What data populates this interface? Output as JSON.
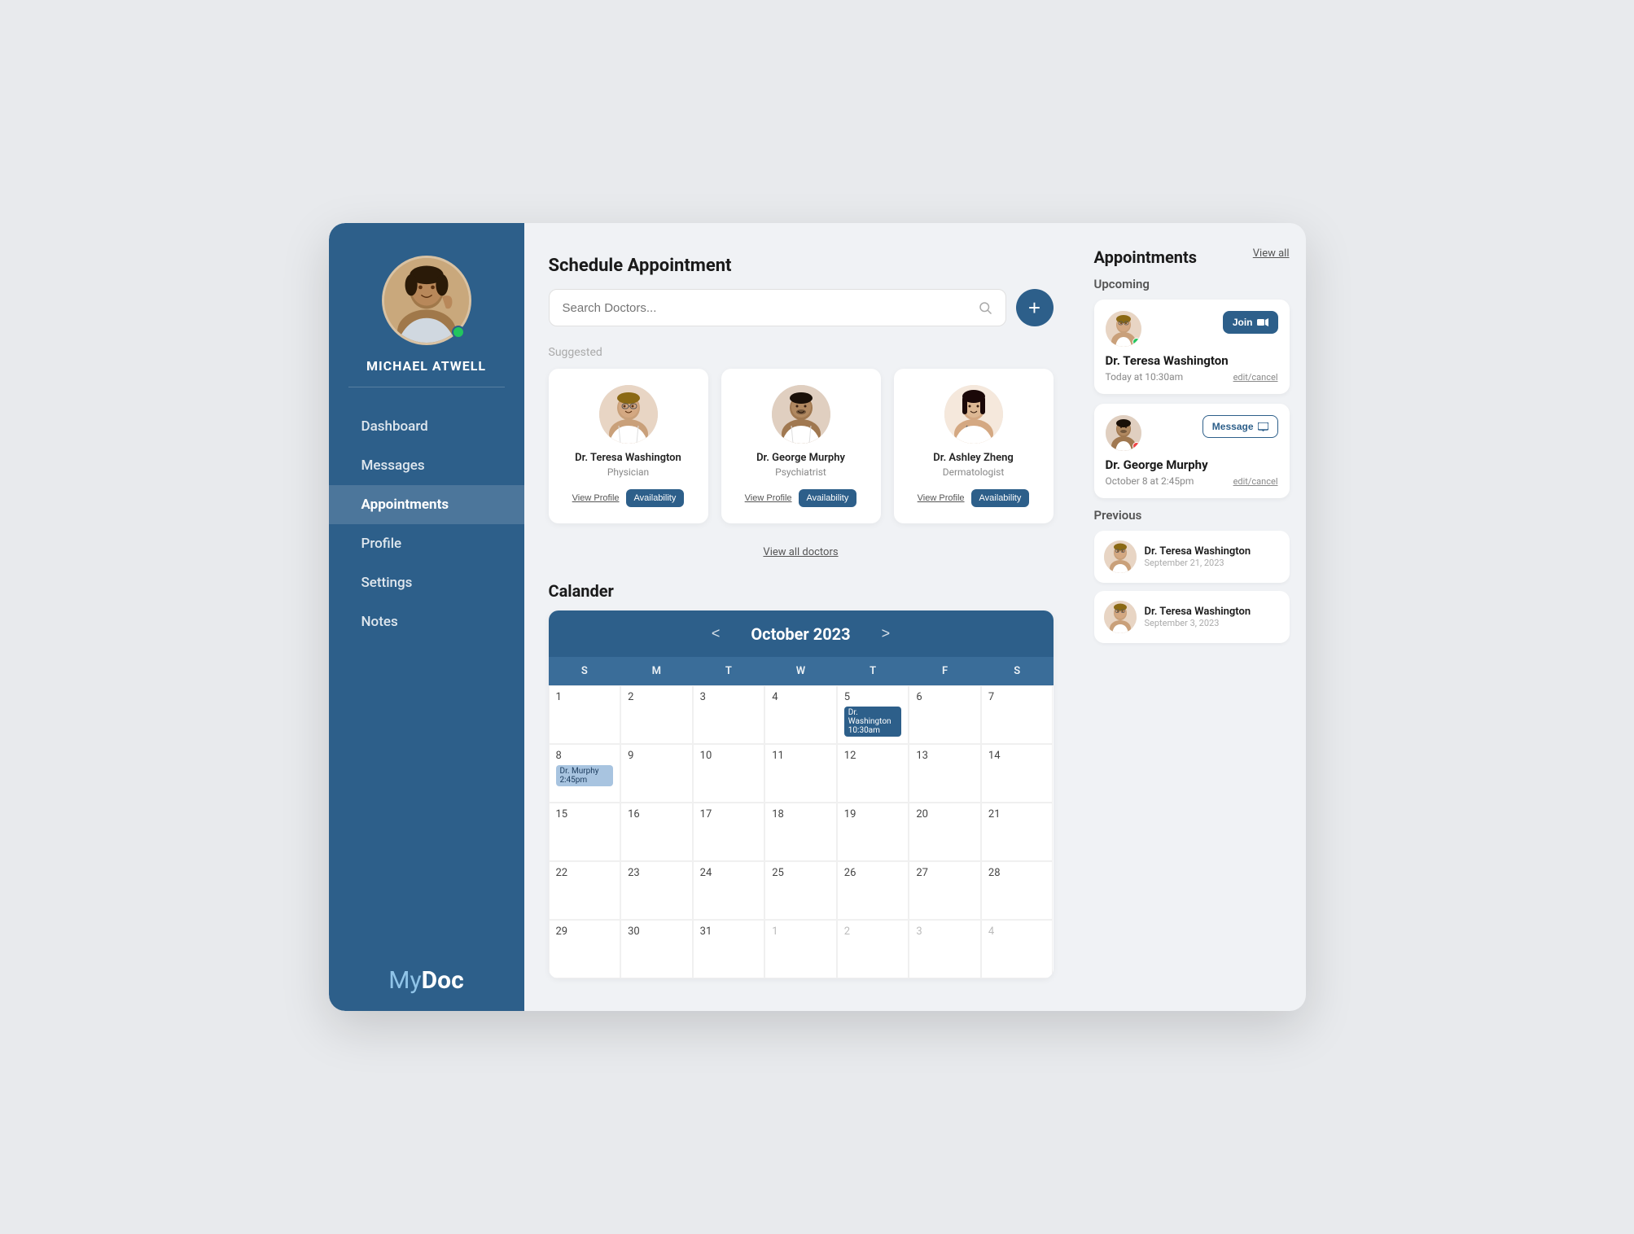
{
  "app": {
    "brand_my": "My",
    "brand_doc": "Doc"
  },
  "sidebar": {
    "user_name": "MICHAEL ATWELL",
    "nav_items": [
      {
        "id": "dashboard",
        "label": "Dashboard",
        "active": false
      },
      {
        "id": "messages",
        "label": "Messages",
        "active": false
      },
      {
        "id": "appointments",
        "label": "Appointments",
        "active": true
      },
      {
        "id": "profile",
        "label": "Profile",
        "active": false
      },
      {
        "id": "settings",
        "label": "Settings",
        "active": false
      },
      {
        "id": "notes",
        "label": "Notes",
        "active": false
      }
    ]
  },
  "schedule": {
    "title": "Schedule Appointment",
    "search_placeholder": "Search Doctors...",
    "add_button_label": "+",
    "suggested_label": "Suggested",
    "view_all_doctors": "View all doctors"
  },
  "doctors": [
    {
      "name": "Dr. Teresa Washington",
      "specialty": "Physician",
      "view_profile": "View Profile",
      "availability": "Availability"
    },
    {
      "name": "Dr. George Murphy",
      "specialty": "Psychiatrist",
      "view_profile": "View Profile",
      "availability": "Availability"
    },
    {
      "name": "Dr. Ashley Zheng",
      "specialty": "Dermatologist",
      "view_profile": "View Profile",
      "availability": "Availability"
    }
  ],
  "calendar": {
    "title": "Calander",
    "month_year": "October 2023",
    "prev_label": "<",
    "next_label": ">",
    "day_headers": [
      "S",
      "M",
      "T",
      "W",
      "T",
      "F",
      "S"
    ],
    "weeks": [
      [
        {
          "date": "1",
          "faded": false,
          "event": null
        },
        {
          "date": "2",
          "faded": false,
          "event": null
        },
        {
          "date": "3",
          "faded": false,
          "event": null
        },
        {
          "date": "4",
          "faded": false,
          "event": null
        },
        {
          "date": "5",
          "faded": false,
          "event": "Dr. Washington 10:30am",
          "highlight": true
        },
        {
          "date": "6",
          "faded": false,
          "event": null
        },
        {
          "date": "7",
          "faded": false,
          "event": null
        }
      ],
      [
        {
          "date": "8",
          "faded": false,
          "event": "Dr. Murphy 2:45pm",
          "highlight": false
        },
        {
          "date": "9",
          "faded": false,
          "event": null
        },
        {
          "date": "10",
          "faded": false,
          "event": null
        },
        {
          "date": "11",
          "faded": false,
          "event": null
        },
        {
          "date": "12",
          "faded": false,
          "event": null
        },
        {
          "date": "13",
          "faded": false,
          "event": null
        },
        {
          "date": "14",
          "faded": false,
          "event": null
        }
      ],
      [
        {
          "date": "15",
          "faded": false,
          "event": null
        },
        {
          "date": "16",
          "faded": false,
          "event": null
        },
        {
          "date": "17",
          "faded": false,
          "event": null
        },
        {
          "date": "18",
          "faded": false,
          "event": null
        },
        {
          "date": "19",
          "faded": false,
          "event": null
        },
        {
          "date": "20",
          "faded": false,
          "event": null
        },
        {
          "date": "21",
          "faded": false,
          "event": null
        }
      ],
      [
        {
          "date": "22",
          "faded": false,
          "event": null
        },
        {
          "date": "23",
          "faded": false,
          "event": null
        },
        {
          "date": "24",
          "faded": false,
          "event": null
        },
        {
          "date": "25",
          "faded": false,
          "event": null
        },
        {
          "date": "26",
          "faded": false,
          "event": null
        },
        {
          "date": "27",
          "faded": false,
          "event": null
        },
        {
          "date": "28",
          "faded": false,
          "event": null
        }
      ],
      [
        {
          "date": "29",
          "faded": false,
          "event": null
        },
        {
          "date": "30",
          "faded": false,
          "event": null
        },
        {
          "date": "31",
          "faded": false,
          "event": null
        },
        {
          "date": "1",
          "faded": true,
          "event": null
        },
        {
          "date": "2",
          "faded": true,
          "event": null
        },
        {
          "date": "3",
          "faded": true,
          "event": null
        },
        {
          "date": "4",
          "faded": true,
          "event": null
        }
      ]
    ]
  },
  "right_panel": {
    "title": "Appointments",
    "view_all": "View all",
    "upcoming_label": "Upcoming",
    "previous_label": "Previous",
    "upcoming": [
      {
        "doctor": "Dr. Teresa Washington",
        "time": "Today at 10:30am",
        "status": "green",
        "action": "Join",
        "edit_cancel": "edit/cancel"
      },
      {
        "doctor": "Dr. George Murphy",
        "time": "October 8 at 2:45pm",
        "status": "red",
        "action": "Message",
        "edit_cancel": "edit/cancel"
      }
    ],
    "previous": [
      {
        "doctor": "Dr. Teresa Washington",
        "date": "September 21, 2023"
      },
      {
        "doctor": "Dr. Teresa Washington",
        "date": "September 3, 2023"
      }
    ]
  }
}
